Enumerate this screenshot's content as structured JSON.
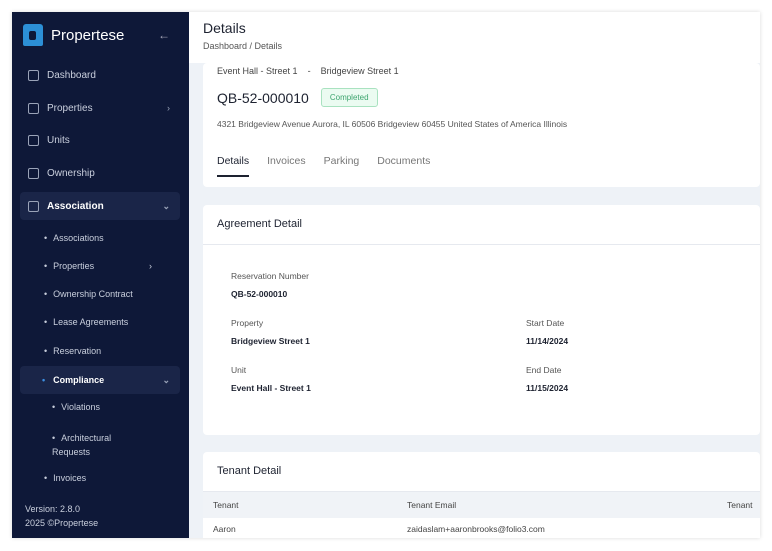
{
  "sidebar": {
    "brand": "Propertese",
    "items": [
      {
        "label": "Dashboard"
      },
      {
        "label": "Properties"
      },
      {
        "label": "Units"
      },
      {
        "label": "Ownership"
      },
      {
        "label": "Association"
      }
    ],
    "sub": [
      "Associations",
      "Properties",
      "Ownership Contract",
      "Lease Agreements",
      "Reservation",
      "Compliance"
    ],
    "compliance_sub": [
      "Violations",
      "Architectural Requests"
    ],
    "invoices": "Invoices",
    "version": "Version: 2.8.0",
    "copyright": "2025 ©Propertese"
  },
  "header": {
    "title": "Details",
    "breadcrumb": "Dashboard / Details"
  },
  "summary": {
    "unit": "Event Hall - Street 1",
    "sep": "-",
    "property": "Bridgeview Street 1",
    "id": "QB-52-000010",
    "status": "Completed",
    "status_color": "#3ea56f",
    "address": "4321 Bridgeview Avenue Aurora, IL 60506 Bridgeview 60455 United States of America Illinois",
    "tabs": [
      "Details",
      "Invoices",
      "Parking",
      "Documents"
    ]
  },
  "agreement": {
    "title": "Agreement Detail",
    "fields": [
      {
        "label": "Reservation Number",
        "value": "QB-52-000010"
      },
      {
        "label": "Property",
        "value": "Bridgeview Street 1"
      },
      {
        "label": "Start Date",
        "value": "11/14/2024"
      },
      {
        "label": "Unit",
        "value": "Event Hall - Street 1"
      },
      {
        "label": "End Date",
        "value": "11/15/2024"
      }
    ]
  },
  "tenant": {
    "title": "Tenant Detail",
    "columns": [
      "Tenant",
      "Tenant Email",
      "Tenant"
    ],
    "rows": [
      [
        "Aaron",
        "zaidaslam+aaronbrooks@folio3.com",
        ""
      ]
    ]
  }
}
